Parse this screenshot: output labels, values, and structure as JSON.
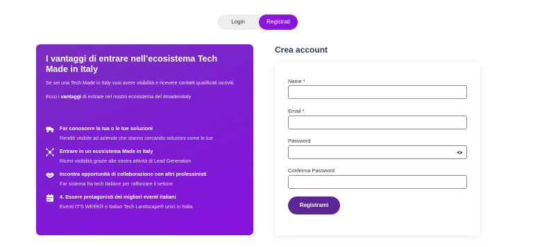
{
  "tabs": {
    "login": "Login",
    "register": "Registrati"
  },
  "promo": {
    "title": "I vantaggi di entrare nell’ecosistema Tech Made in Italy",
    "intro": "Se sei una Tech Made in Italy vuoi avere visibilità e ricevere contatti qualificati iscriviti.",
    "intro2_before": "Ecco i ",
    "intro2_bold": "vantaggi",
    "intro2_after": " di entrare nel nostro ecosistema del #madeinitaly",
    "benefits": [
      {
        "icon": "truck-icon",
        "title": "Far conoscere la tua o le tue soluzioni",
        "desc": "Renditi visibile ad aziende che stanno cercando soluzioni come le tue"
      },
      {
        "icon": "network-icon",
        "title": "Entrare in un ecosistema Made in Italy",
        "desc": "Ricevi visibilità grazie alle nostra attività di Lead Generation"
      },
      {
        "icon": "handshake-icon",
        "title": "Incontra opportunità di collaborazione con altri professinisti",
        "desc": "Far sistema fra tech Italiane per rafforzare il settore"
      },
      {
        "icon": "calendar-icon",
        "title": "4. Essere protagonisti dei migliori eventi italiani",
        "desc": "Eventi IT’S WEEK® e Italian Tech Landscape® unici in Italia"
      }
    ]
  },
  "form": {
    "title": "Crea account",
    "fields": {
      "name": {
        "label": "Name *",
        "value": ""
      },
      "email": {
        "label": "Email *",
        "value": ""
      },
      "password": {
        "label": "Password",
        "value": ""
      },
      "confirm": {
        "label": "Conferma Password",
        "value": ""
      }
    },
    "submit": "Registrami"
  },
  "colors": {
    "accent": "#8a16dc",
    "button": "#5c2795",
    "title": "#2d3b52"
  }
}
